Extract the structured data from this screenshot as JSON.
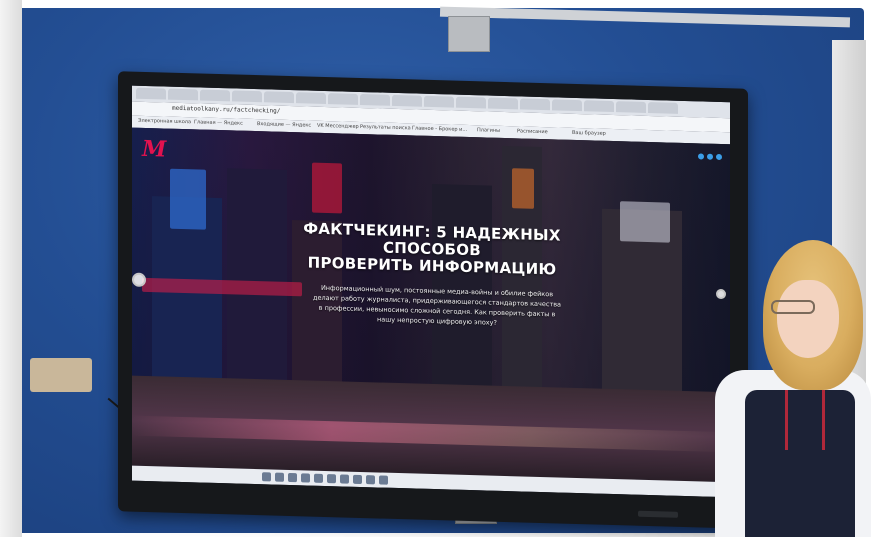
{
  "browser": {
    "url": "mediatoolkany.ru/factchecking/",
    "bookmarks": [
      "Электронная школа",
      "Главная — Яндекс",
      "Входящие — Яндекс",
      "VK Мессенджер",
      "Результаты поиска",
      "Главное - Брокер и...",
      "Плагины",
      "Расписание",
      "Ваш браузер"
    ]
  },
  "page": {
    "logo": "М",
    "headline_line1": "ФАКТЧЕКИНГ: 5 НАДЕЖНЫХ СПОСОБОВ",
    "headline_line2": "ПРОВЕРИТЬ ИНФОРМАЦИЮ",
    "subtext": "Информационный шум, постоянные медиа-войны и обилие фейков делают работу журналиста, придерживающегося стандартов качества в профессии, невыносимо сложной сегодня. Как проверить факты в нашу непростую цифровую эпоху?"
  },
  "colors": {
    "logo": "#e2124f",
    "wall": "#234e93"
  }
}
